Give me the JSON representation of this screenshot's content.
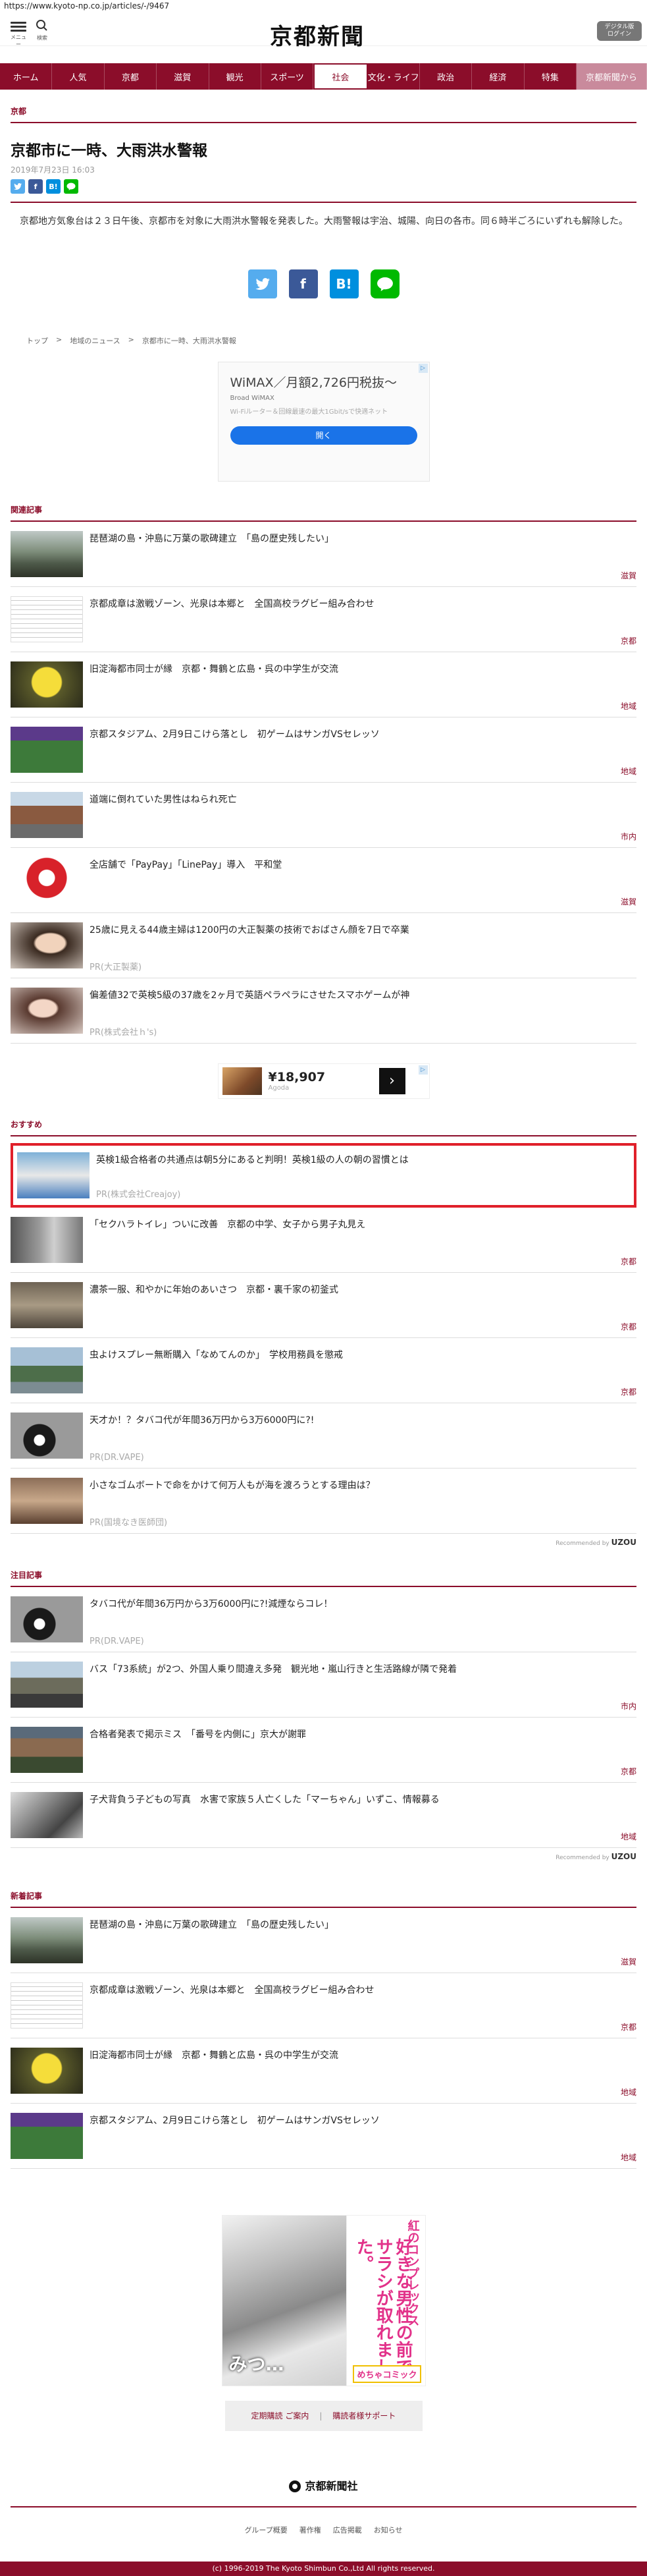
{
  "browser": {
    "url": "https://www.kyoto-np.co.jp/articles/-/9467"
  },
  "header": {
    "menu_label": "メニュー",
    "search_label": "検索",
    "logo": "京都新聞",
    "digital_button": "デジタル版 ログイン"
  },
  "nav": {
    "items": [
      "ホーム",
      "人気",
      "京都",
      "滋賀",
      "観光",
      "スポーツ",
      "社会",
      "文化・ライフ",
      "政治",
      "経済",
      "特集",
      "京都新聞から"
    ],
    "active": "社会"
  },
  "article": {
    "section": "京都",
    "title": "京都市に一時、大雨洪水警報",
    "date": "2019年7月23日 16:03",
    "body": "京都地方気象台は２３日午後、京都市を対象に大雨洪水警報を発表した。大雨警報は宇治、城陽、向日の各市。同６時半ごろにいずれも解除した。"
  },
  "share": {
    "twitter": "twitter-icon",
    "facebook": "f",
    "hatena": "B!",
    "line": "LINE"
  },
  "breadcrumb": [
    "トップ",
    ">",
    "地域のニュース",
    ">",
    "京都市に一時、大雨洪水警報"
  ],
  "ad_wimax": {
    "headline": "WiMAX／月額2,726円税抜～",
    "brand": "Broad WiMAX",
    "desc": "Wi-Fiルーター＆回線最速の最大1Gbit/sで快適ネット",
    "button": "開く",
    "adchoices": "▷"
  },
  "related": {
    "title": "関連記事",
    "items": [
      {
        "title": "琵琶湖の島・沖島に万葉の歌碑建立　「島の歴史残したい」",
        "category": "滋賀",
        "pr": ""
      },
      {
        "title": "京都成章は激戦ゾーン、光泉は本郷と　全国高校ラグビー組み合わせ",
        "category": "京都",
        "pr": ""
      },
      {
        "title": "旧淀海都市同士が縁　京都・舞鶴と広島・呉の中学生が交流",
        "category": "地域",
        "pr": ""
      },
      {
        "title": "京都スタジアム、2月9日こけら落とし　初ゲームはサンガVSセレッソ",
        "category": "地域",
        "pr": ""
      },
      {
        "title": "道端に倒れていた男性はねられ死亡",
        "category": "市内",
        "pr": ""
      },
      {
        "title": "全店舗で「PayPay」「LinePay」導入　平和堂",
        "category": "滋賀",
        "pr": ""
      },
      {
        "title": "25歳に見える44歳主婦は1200円の大正製薬の技術でおばさん顔を7日で卒業",
        "category": "",
        "pr": "PR(大正製薬)"
      },
      {
        "title": "偏差値32で英検5級の37歳を2ヶ月で英語ペラペラにさせたスマホゲームが神",
        "category": "",
        "pr": "PR(株式会社ｈ's)"
      }
    ]
  },
  "ad_agoda": {
    "price": "¥18,907",
    "brand": "Agoda",
    "arrow": "›"
  },
  "recommend": {
    "title": "おすすめ",
    "items": [
      {
        "title": "英検1級合格者の共通点は朝5分にあると判明！英検1級の人の朝の習慣とは",
        "category": "",
        "pr": "PR(株式会社Creajoy)"
      },
      {
        "title": "「セクハラトイレ」ついに改善　京都の中学、女子から男子丸見え",
        "category": "京都",
        "pr": ""
      },
      {
        "title": "濃茶一服、和やかに年始のあいさつ　京都・裏千家の初釜式",
        "category": "京都",
        "pr": ""
      },
      {
        "title": "虫よけスプレー無断購入「なめてんのか」　学校用務員を懲戒",
        "category": "京都",
        "pr": ""
      },
      {
        "title": "天才か！？タバコ代が年間36万円から3万6000円に?!",
        "category": "",
        "pr": "PR(DR.VAPE)"
      },
      {
        "title": "小さなゴムボートで命をかけて何万人もが海を渡ろうとする理由は？",
        "category": "",
        "pr": "PR(国境なき医師団)"
      }
    ],
    "recommended_by": "Recommended by",
    "uzou": "UZOU"
  },
  "featured": {
    "title": "注目記事",
    "items": [
      {
        "title": "タバコ代が年間36万円から3万6000円に?!減煙ならコレ！",
        "category": "",
        "pr": "PR(DR.VAPE)"
      },
      {
        "title": "バス「73系統」が2つ、外国人乗り間違え多発　観光地・嵐山行きと生活路線が隣で発着",
        "category": "市内",
        "pr": ""
      },
      {
        "title": "合格者発表で掲示ミス　「番号を内側に」京大が謝罪",
        "category": "京都",
        "pr": ""
      },
      {
        "title": "子犬背負う子どもの写真　水害で家族５人亡くした「マーちゃん」いずこ、情報募る",
        "category": "地域",
        "pr": ""
      }
    ],
    "recommended_by": "Recommended by",
    "uzou": "UZOU"
  },
  "latest": {
    "title": "新着記事",
    "items": [
      {
        "title": "琵琶湖の島・沖島に万葉の歌碑建立　「島の歴史残したい」",
        "category": "滋賀",
        "pr": ""
      },
      {
        "title": "京都成章は激戦ゾーン、光泉は本郷と　全国高校ラグビー組み合わせ",
        "category": "京都",
        "pr": ""
      },
      {
        "title": "旧淀海都市同士が縁　京都・舞鶴と広島・呉の中学生が交流",
        "category": "地域",
        "pr": ""
      },
      {
        "title": "京都スタジアム、2月9日こけら落とし　初ゲームはサンガVSセレッソ",
        "category": "地域",
        "pr": ""
      }
    ]
  },
  "manga_ad": {
    "left_text": "みつ…",
    "right_top": "紅のコンプレックス",
    "right_main": "好きな男性の前でサラシが取れました。",
    "right_badge": "めちゃコミック"
  },
  "footer": {
    "links": [
      "定期購読 ご案内",
      "|",
      "購読者様サポート"
    ],
    "logo": "京都新聞社",
    "nav": [
      "グループ概要",
      "著作権",
      "広告掲載",
      "お知らせ"
    ],
    "copyright": "(c) 1996-2019 The Kyoto Shimbun Co.,Ltd All rights reserved."
  }
}
